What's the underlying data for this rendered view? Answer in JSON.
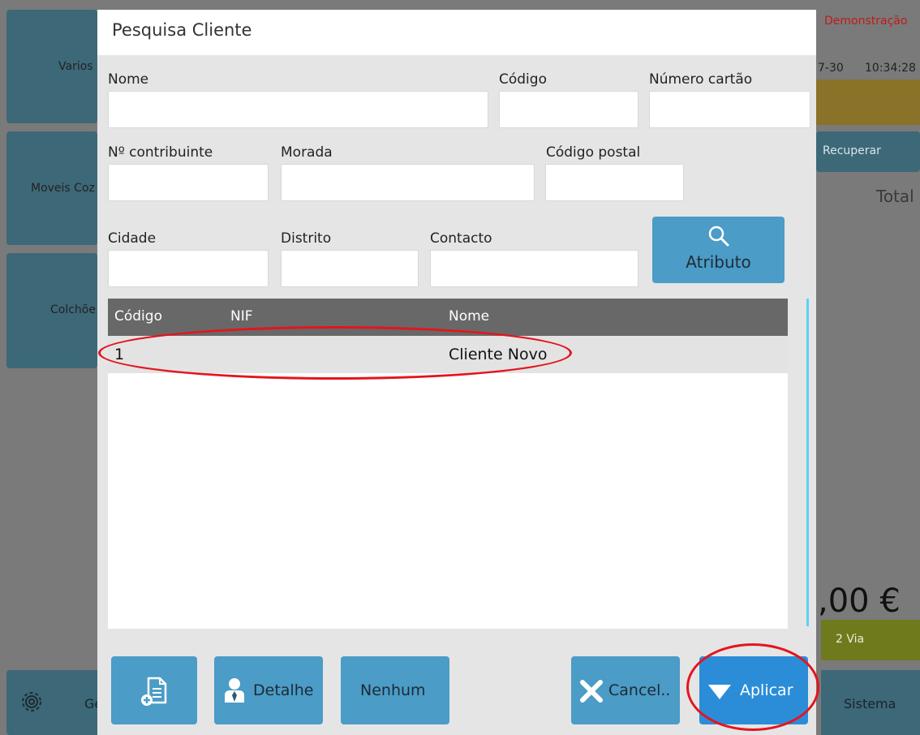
{
  "background": {
    "tiles": [
      "Varios",
      "Moveis Coz",
      "Colchõe"
    ],
    "demo_label": "Demonstração",
    "date_fragment": "7-30",
    "time": "10:34:28",
    "recuperar_label": "Recuperar",
    "total_label": "Total",
    "amount": ",00 €",
    "segunda_via_label": "2 Via",
    "sistema_label": "Sistema",
    "gear_button_label": "Ge"
  },
  "dialog": {
    "title": "Pesquisa Cliente",
    "fields": {
      "nome": {
        "label": "Nome",
        "value": ""
      },
      "codigo": {
        "label": "Código",
        "value": ""
      },
      "numero_cartao": {
        "label": "Número cartão",
        "value": ""
      },
      "contribuinte": {
        "label": "Nº contribuinte",
        "value": ""
      },
      "morada": {
        "label": "Morada",
        "value": ""
      },
      "codigo_postal": {
        "label": "Código postal",
        "value": ""
      },
      "cidade": {
        "label": "Cidade",
        "value": ""
      },
      "distrito": {
        "label": "Distrito",
        "value": ""
      },
      "contacto": {
        "label": "Contacto",
        "value": ""
      }
    },
    "atributo_label": "Atributo",
    "results": {
      "columns": [
        "Código",
        "NIF",
        "Nome"
      ],
      "rows": [
        {
          "codigo": "1",
          "nif": "",
          "nome": "Cliente Novo"
        }
      ]
    },
    "buttons": {
      "new_document_icon": "new-document-icon",
      "detalhe": "Detalhe",
      "nenhum": "Nenhum",
      "cancel": "Cancel..",
      "aplicar": "Aplicar"
    }
  },
  "colors": {
    "tile": "#3d6878",
    "button": "#4b9cc7",
    "apply_button": "#2b8dd8",
    "header_row": "#686868",
    "highlight": "#e4141e"
  }
}
